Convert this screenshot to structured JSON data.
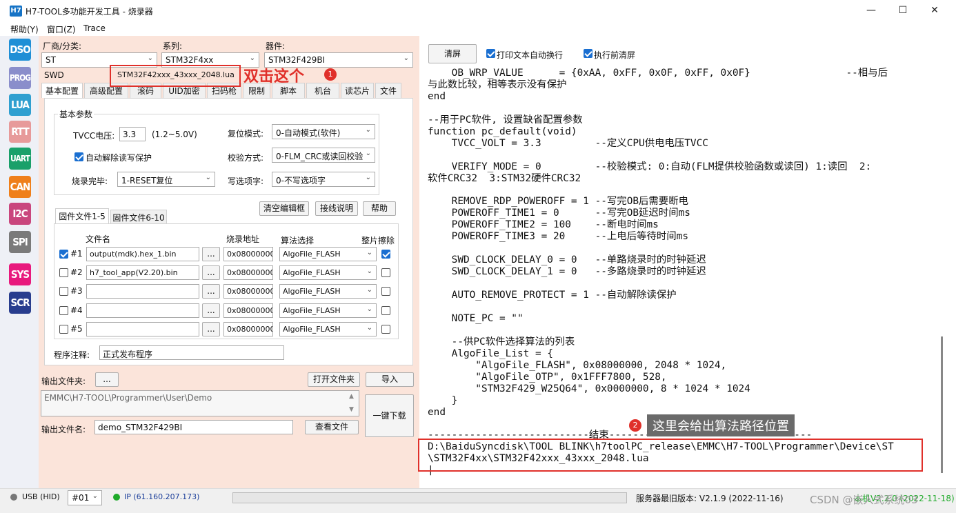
{
  "window": {
    "app_icon": "H7",
    "title": "H7-TOOL多功能开发工具 - 烧录器",
    "minimize": "—",
    "maximize": "☐",
    "close": "✕"
  },
  "menu": [
    "帮助(Y)",
    "窗口(Z)",
    "Trace"
  ],
  "sidebar": [
    {
      "label": "DSO",
      "color": "#1f8fd6"
    },
    {
      "label": "PROG",
      "color": "#8a8ecb"
    },
    {
      "label": "LUA",
      "color": "#2f9fd0"
    },
    {
      "label": "RTT",
      "color": "#e79a9a"
    },
    {
      "label": "UART",
      "color": "#1aa06a"
    },
    {
      "label": "CAN",
      "color": "#ef7f1a"
    },
    {
      "label": "I2C",
      "color": "#c9467d"
    },
    {
      "label": "SPI",
      "color": "#7a7a7a"
    },
    {
      "label": "SYS",
      "color": "#e8197d"
    },
    {
      "label": "SCR",
      "color": "#283d8e"
    }
  ],
  "selectors": {
    "vendor_label": "厂商/分类:",
    "vendor_value": "ST",
    "series_label": "系列:",
    "series_value": "STM32F4xx",
    "device_label": "器件:",
    "device_value": "STM32F429BI",
    "interface": "SWD",
    "lua_file": "STM32F42xxx_43xxx_2048.lua"
  },
  "tabs": [
    "基本配置",
    "高级配置",
    "滚码",
    "UID加密",
    "扫码枪",
    "限制",
    "脚本",
    "机台",
    "读芯片",
    "文件"
  ],
  "basic": {
    "group_title": "基本参数",
    "tvcc_label": "TVCC电压:",
    "tvcc_value": "3.3",
    "tvcc_range": "(1.2~5.0V)",
    "reset_label": "复位模式:",
    "reset_value": "0-自动模式(软件)",
    "auto_unprotect": "自动解除读写保护",
    "verify_label": "校验方式:",
    "verify_value": "0-FLM_CRC或读回校验",
    "after_label": "烧录完毕:",
    "after_value": "1-RESET复位",
    "option_label": "写选项字:",
    "option_value": "0-不写选项字"
  },
  "buttons": {
    "clear_edit": "清空编辑框",
    "wiring": "接线说明",
    "help": "帮助"
  },
  "file_tabs": [
    "固件文件1-5",
    "固件文件6-10"
  ],
  "file_headers": {
    "name": "文件名",
    "addr": "烧录地址",
    "algo": "算法选择",
    "erase": "整片擦除"
  },
  "files": [
    {
      "id": "#1",
      "checked": true,
      "name": "output(mdk).hex_1.bin",
      "browse": "...",
      "addr": "0x08000000",
      "algo": "AlgoFile_FLASH",
      "erase": true
    },
    {
      "id": "#2",
      "checked": false,
      "name": "h7_tool_app(V2.20).bin",
      "browse": "...",
      "addr": "0x08000000",
      "algo": "AlgoFile_FLASH",
      "erase": false
    },
    {
      "id": "#3",
      "checked": false,
      "name": "",
      "browse": "...",
      "addr": "0x08000000",
      "algo": "AlgoFile_FLASH",
      "erase": false
    },
    {
      "id": "#4",
      "checked": false,
      "name": "",
      "browse": "...",
      "addr": "0x08000000",
      "algo": "AlgoFile_FLASH",
      "erase": false
    },
    {
      "id": "#5",
      "checked": false,
      "name": "",
      "browse": "...",
      "addr": "0x08000000",
      "algo": "AlgoFile_FLASH",
      "erase": false
    }
  ],
  "note": {
    "label": "程序注释:",
    "value": "正式发布程序"
  },
  "output": {
    "folder_label": "输出文件夹:",
    "browse": "...",
    "open_folder": "打开文件夹",
    "import": "导入",
    "path": "EMMC\\H7-TOOL\\Programmer\\User\\Demo",
    "one_click": "一键下载",
    "file_label": "输出文件名:",
    "file_value": "demo_STM32F429BI",
    "view_file": "查看文件"
  },
  "right_toolbar": {
    "clear": "清屏",
    "wrap": "打印文本自动换行",
    "clear_before": "执行前清屏"
  },
  "code_lines": [
    "    OB_WRP_VALUE      = {0xAA, 0xFF, 0x0F, 0xFF, 0x0F}                --相与后",
    "与此数比较，相等表示没有保护",
    "end",
    "",
    "--用于PC软件, 设置缺省配置参数",
    "function pc_default(void)",
    "    TVCC_VOLT = 3.3         --定义CPU供电电压TVCC",
    "",
    "    VERIFY_MODE = 0         --校验模式: 0:自动(FLM提供校验函数或读回) 1:读回  2:",
    "软件CRC32  3:STM32硬件CRC32",
    "",
    "    REMOVE_RDP_POWEROFF = 1 --写完OB后需要断电",
    "    POWEROFF_TIME1 = 0      --写完OB延迟时间ms",
    "    POWEROFF_TIME2 = 100    --断电时间ms",
    "    POWEROFF_TIME3 = 20     --上电后等待时间ms",
    "",
    "    SWD_CLOCK_DELAY_0 = 0   --单路烧录时的时钟延迟",
    "    SWD_CLOCK_DELAY_1 = 0   --多路烧录时的时钟延迟",
    "",
    "    AUTO_REMOVE_PROTECT = 1 --自动解除读保护",
    "",
    "    NOTE_PC = \"\"",
    "",
    "    --供PC软件选择算法的列表",
    "    AlgoFile_List = {",
    "        \"AlgoFile_FLASH\", 0x08000000, 2048 * 1024,",
    "        \"AlgoFile_OTP\", 0x1FFF7800, 528,",
    "        \"STM32F429_W25Q64\", 0x0000000, 8 * 1024 * 1024",
    "    }",
    "end",
    "",
    "---------------------------结束----------------------------------",
    "D:\\BaiduSyncdisk\\TOOL BLINK\\h7toolPC_release\\EMMC\\H7-TOOL\\Programmer\\Device\\ST",
    "\\STM32F4xx\\STM32F42xxx_43xxx_2048.lua",
    "|"
  ],
  "annotations": {
    "a1_text": "双击这个",
    "a1_num": "1",
    "a2_text": "这里会给出算法路径位置",
    "a2_num": "2"
  },
  "status": {
    "usb": "USB (HID)",
    "port": "#01",
    "ip": "IP (61.160.207.173)",
    "server": "服务器最旧版本: V2.1.9 (2022-11-16)",
    "local": "本机V2.2.0 (2022-11-18)",
    "watermark": "CSDN @嵌入式系统03"
  }
}
